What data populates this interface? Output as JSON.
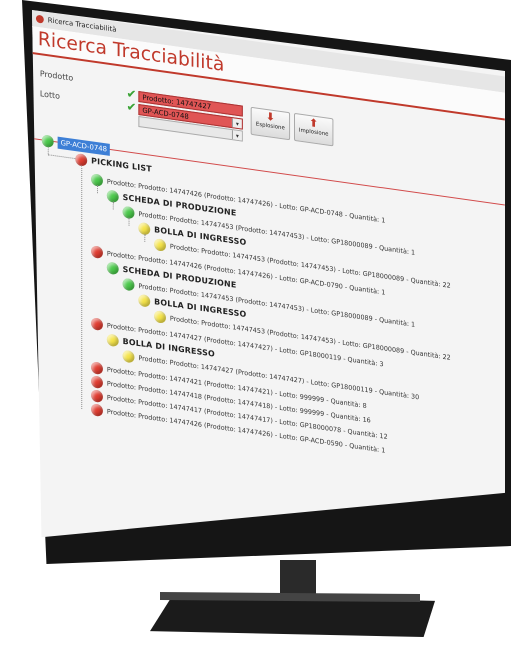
{
  "window": {
    "title": "Ricerca Tracciabilità"
  },
  "banner": {
    "title": "Ricerca Tracciabilità"
  },
  "form": {
    "prodotto_label": "Prodotto",
    "lotto_label": "Lotto",
    "prodotto_value": "Prodotto: 14747427",
    "lotto_value": "GP-ACD-0748"
  },
  "buttons": {
    "esplosione": "Esplosione",
    "implosione": "Implosione"
  },
  "tree": {
    "root": "GP-ACD-0748",
    "picking": "PICKING LIST",
    "nodes": [
      "Prodotto: Prodotto: 14747426 (Prodotto: 14747426) - Lotto: GP-ACD-0748 - Quantità: 1",
      "SCHEDA DI PRODUZIONE",
      "Prodotto: Prodotto: 14747453 (Prodotto: 14747453) - Lotto: GP18000089 - Quantità: 1",
      "BOLLA DI INGRESSO",
      "Prodotto: Prodotto: 14747453 (Prodotto: 14747453) - Lotto: GP18000089 - Quantità: 22",
      "Prodotto: Prodotto: 14747426 (Prodotto: 14747426) - Lotto: GP-ACD-0790 - Quantità: 1",
      "SCHEDA DI PRODUZIONE",
      "Prodotto: Prodotto: 14747453 (Prodotto: 14747453) - Lotto: GP18000089 - Quantità: 1",
      "BOLLA DI INGRESSO",
      "Prodotto: Prodotto: 14747453 (Prodotto: 14747453) - Lotto: GP18000089 - Quantità: 22",
      "Prodotto: Prodotto: 14747427 (Prodotto: 14747427) - Lotto: GP18000119 - Quantità: 3",
      "BOLLA DI INGRESSO",
      "Prodotto: Prodotto: 14747427 (Prodotto: 14747427) - Lotto: GP18000119 - Quantità: 30",
      "Prodotto: Prodotto: 14747421 (Prodotto: 14747421) - Lotto: 999999 - Quantità: 8",
      "Prodotto: Prodotto: 14747418 (Prodotto: 14747418) - Lotto: 999999 - Quantità: 16",
      "Prodotto: Prodotto: 14747417 (Prodotto: 14747417) - Lotto: GP18000078 - Quantità: 12",
      "Prodotto: Prodotto: 14747426 (Prodotto: 14747426) - Lotto: GP-ACD-0590 - Quantità: 1"
    ]
  },
  "colors": {
    "accent": "#c0392b",
    "ok": "#4bc94b",
    "warn": "#f5e44a",
    "error": "#e03d31",
    "selection": "#3d7fd6"
  }
}
